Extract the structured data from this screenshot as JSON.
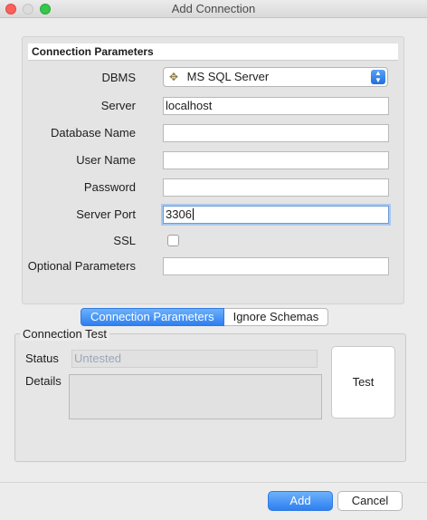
{
  "window": {
    "title": "Add Connection"
  },
  "section": {
    "title": "Connection Parameters"
  },
  "form": {
    "dbms_label": "DBMS",
    "dbms_value": "MS SQL Server",
    "server_label": "Server",
    "server_value": "localhost",
    "database_label": "Database Name",
    "database_value": "",
    "user_label": "User Name",
    "user_value": "",
    "password_label": "Password",
    "password_value": "",
    "port_label": "Server Port",
    "port_value": "3306",
    "ssl_label": "SSL",
    "ssl_checked": false,
    "optional_label": "Optional Parameters",
    "optional_value": ""
  },
  "tabs": [
    {
      "label": "Connection Parameters",
      "active": true
    },
    {
      "label": "Ignore Schemas",
      "active": false
    }
  ],
  "connection_test": {
    "legend": "Connection Test",
    "status_label": "Status",
    "status_value": "Untested",
    "details_label": "Details",
    "test_button": "Test"
  },
  "footer": {
    "add_button": "Add",
    "cancel_button": "Cancel"
  },
  "colors": {
    "accent": "#2e7ff0",
    "close": "#fc605c",
    "maximize": "#34c84a"
  }
}
